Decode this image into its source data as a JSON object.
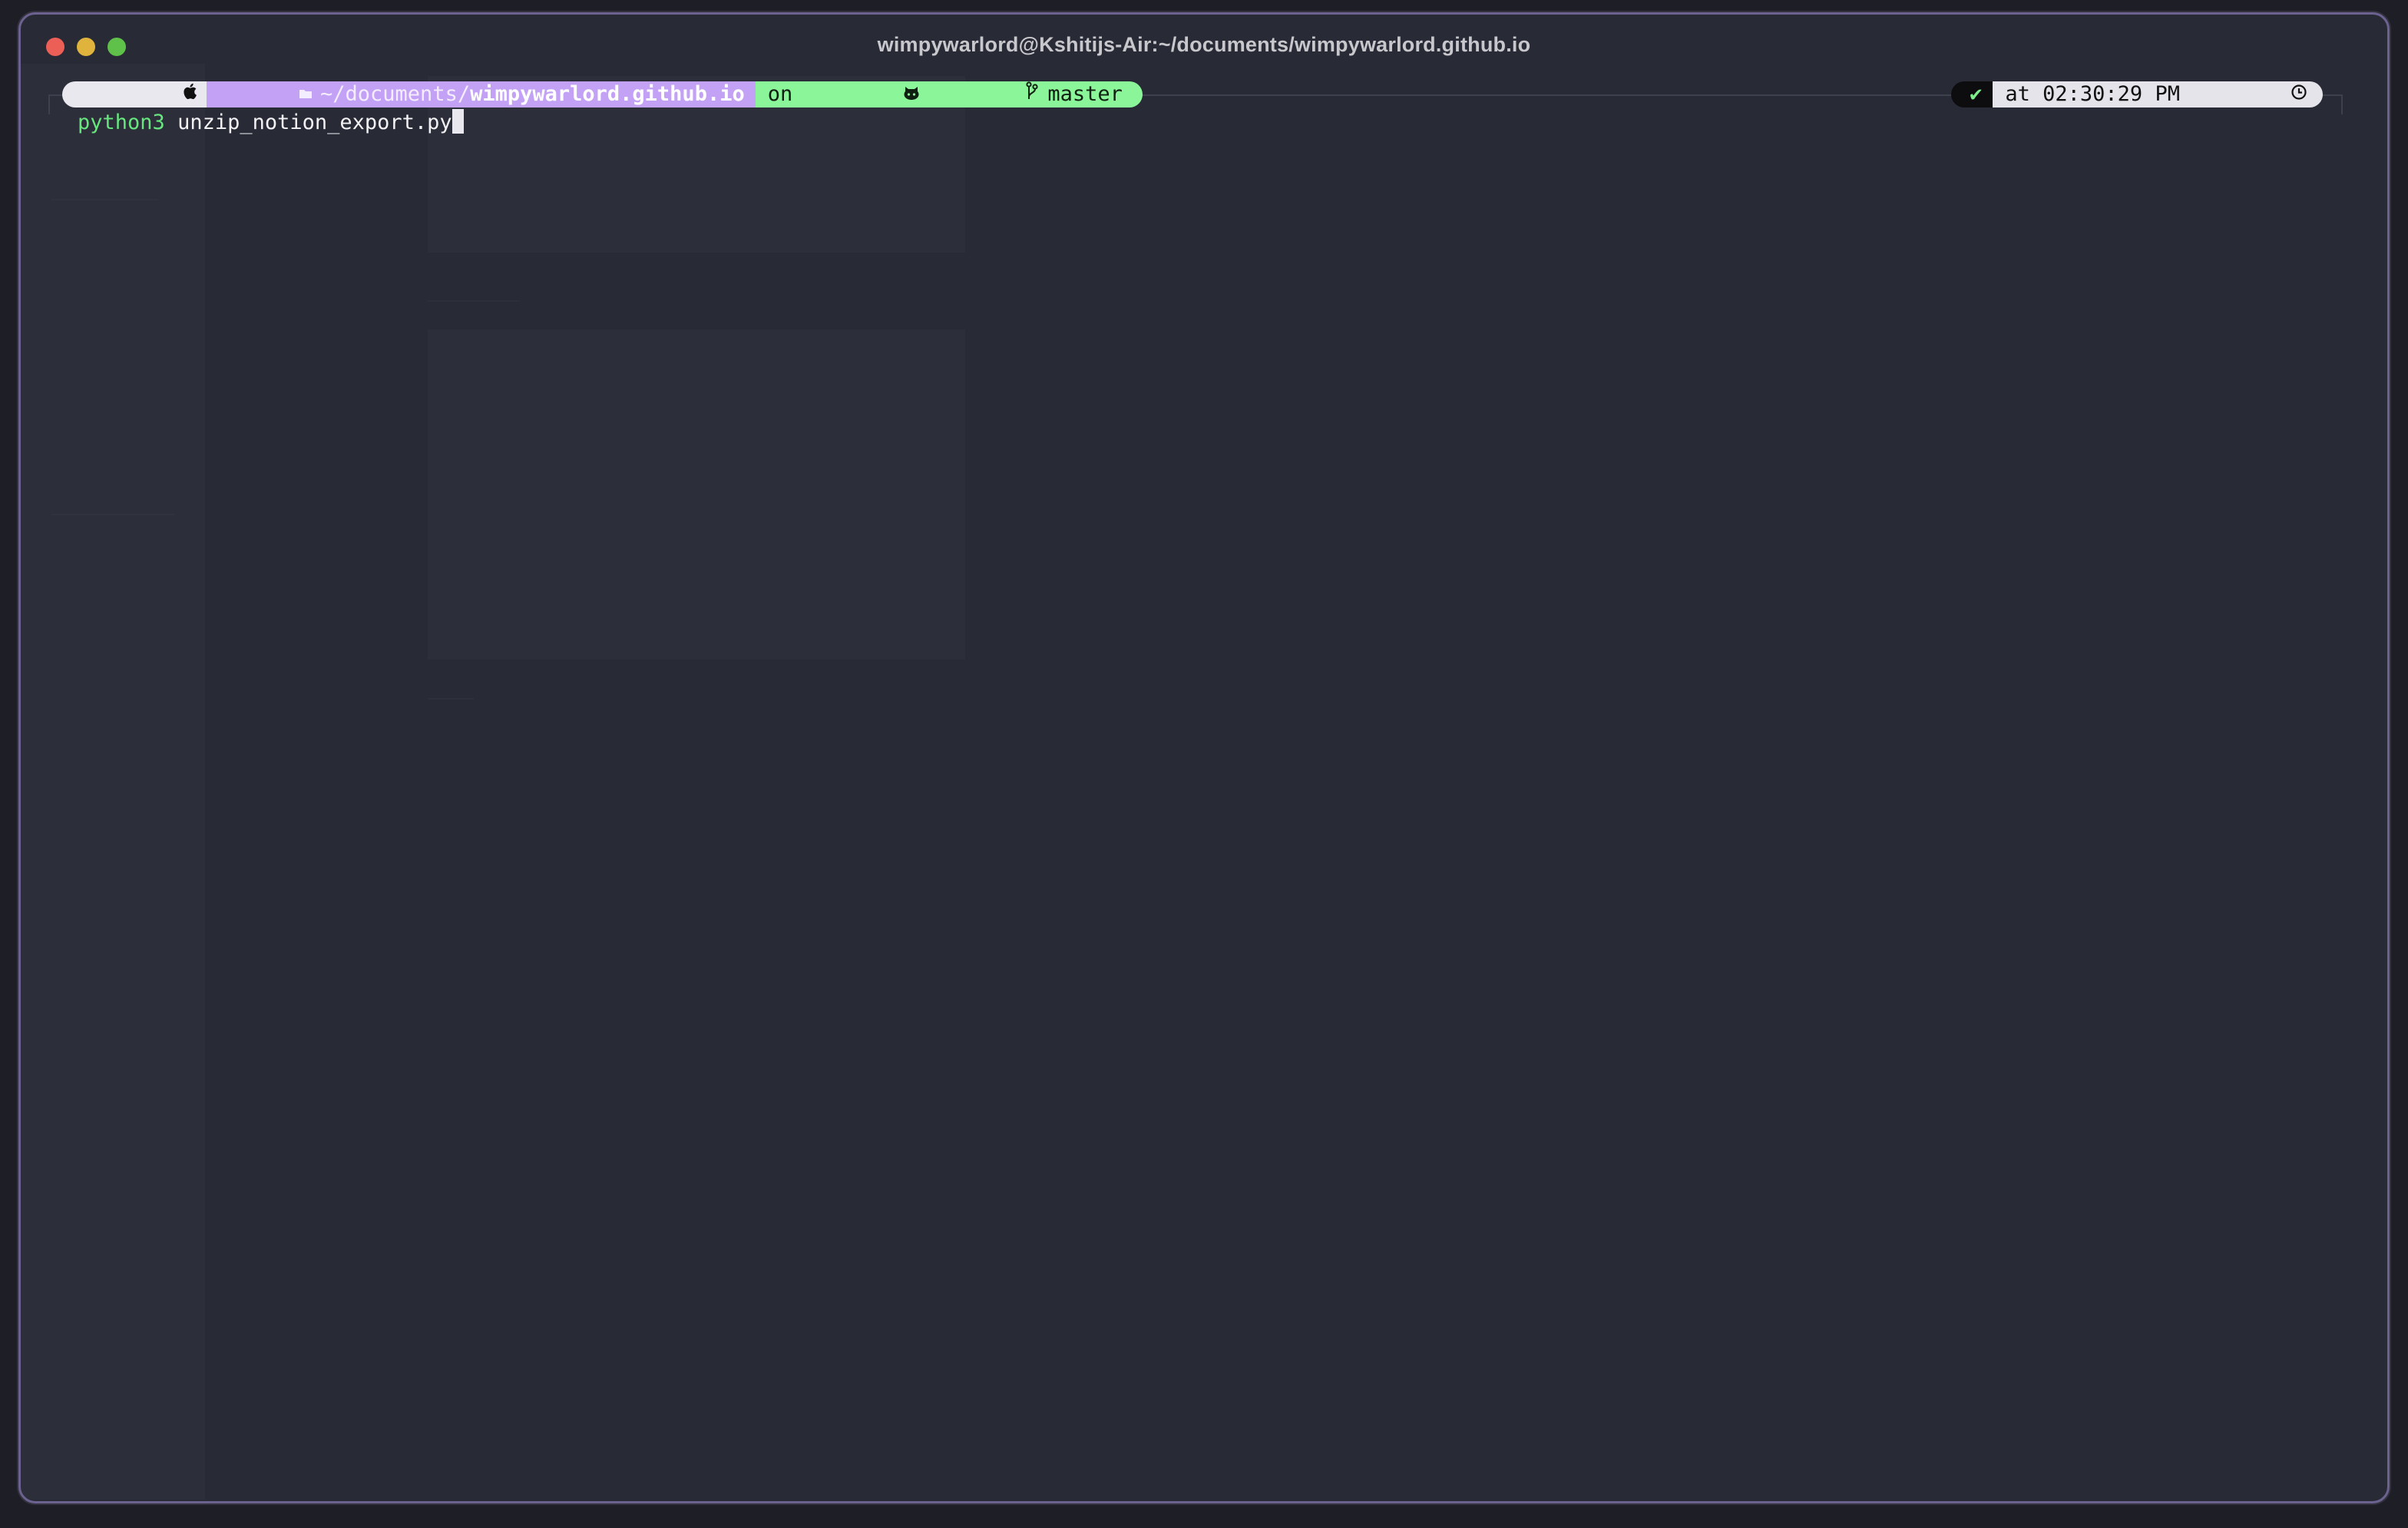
{
  "window": {
    "title": "wimpywarlord@Kshitijs-Air:~/documents/wimpywarlord.github.io"
  },
  "prompt": {
    "os_icon": "apple-icon",
    "dir_icon": "folder-icon",
    "dir_prefix": "~/documents/",
    "dir_current": "wimpywarlord.github.io",
    "git_on": "on",
    "git_host_icon": "github-icon",
    "branch_icon": "git-branch-icon",
    "branch": "master",
    "status_check": "✔",
    "time_prefix": "at",
    "time": "02:30:29 PM",
    "clock_icon": "clock-icon"
  },
  "command": {
    "program": "python3",
    "args": "unzip_notion_export.py"
  },
  "colors": {
    "terminal_bg": "#282a36",
    "dir_segment": "#c3a2f6",
    "git_segment": "#8bf59a",
    "command_green": "#68e67e"
  }
}
